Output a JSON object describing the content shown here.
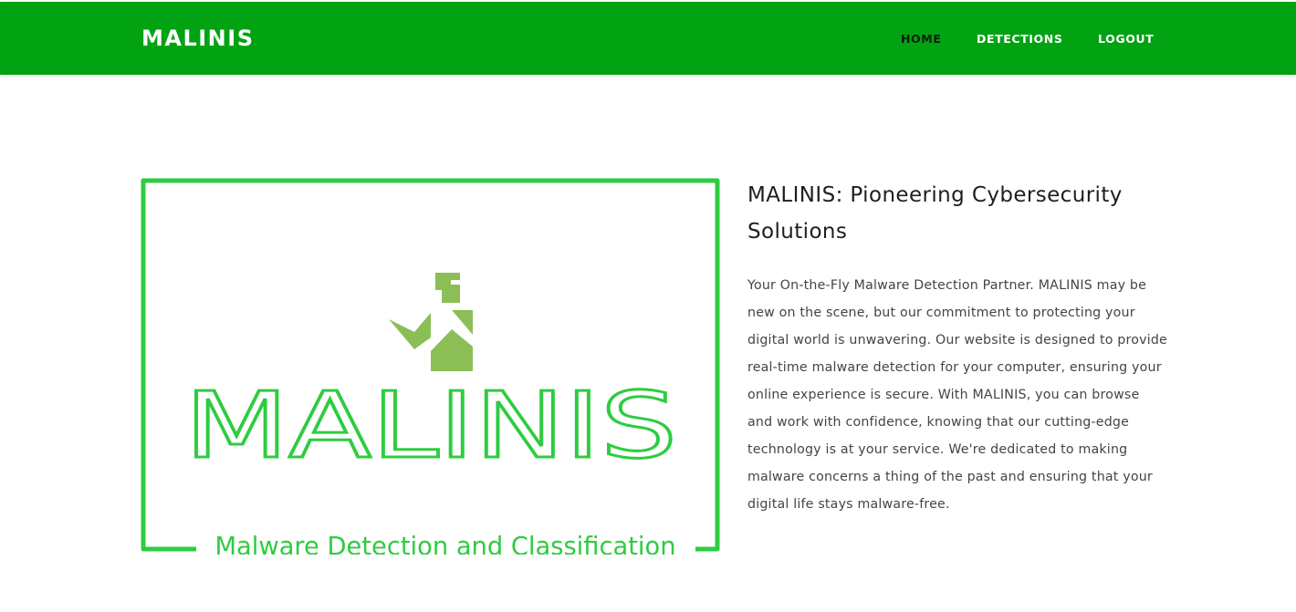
{
  "navbar": {
    "brand": "MALINIS",
    "links": [
      {
        "label": "HOME",
        "active": true
      },
      {
        "label": "DETECTIONS",
        "active": false
      },
      {
        "label": "LOGOUT",
        "active": false
      }
    ],
    "background_color": "#02a312"
  },
  "logo": {
    "wordmark": "MALINIS",
    "tagline": "Malware Detection and Classification",
    "frame_color": "#2ecc40",
    "mascot_color": "#8bbf56"
  },
  "hero": {
    "title": "MALINIS: Pioneering Cybersecurity Solutions",
    "description": "Your On-the-Fly Malware Detection Partner. MALINIS may be new on the scene, but our commitment to protecting your digital world is unwavering. Our website is designed to provide real-time malware detection for your computer, ensuring your online experience is secure. With MALINIS, you can browse and work with confidence, knowing that our cutting-edge technology is at your service. We're dedicated to making malware concerns a thing of the past and ensuring that your digital life stays malware-free."
  }
}
